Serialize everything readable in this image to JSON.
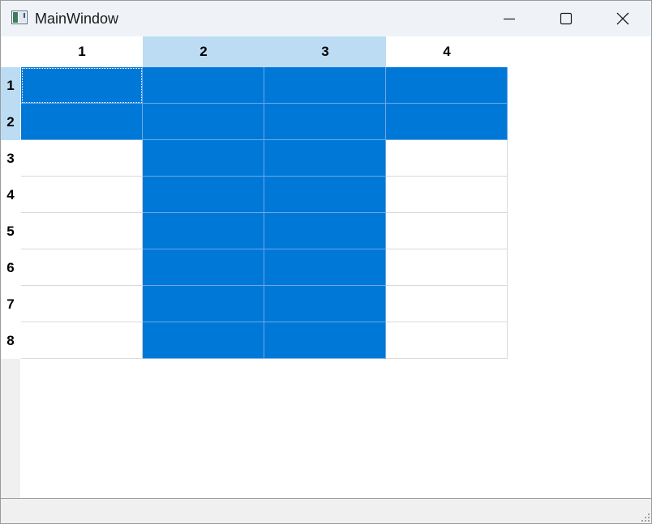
{
  "window": {
    "title": "MainWindow",
    "minimize_icon": "minimize-icon",
    "maximize_icon": "maximize-icon",
    "close_icon": "close-icon",
    "app_icon": "app-window-icon"
  },
  "table": {
    "columns": [
      "1",
      "2",
      "3",
      "4"
    ],
    "rows": [
      "1",
      "2",
      "3",
      "4",
      "5",
      "6",
      "7",
      "8"
    ],
    "selected_rows": [
      "1",
      "2"
    ],
    "selected_columns": [
      "2",
      "3"
    ],
    "focused_cell": {
      "row": "1",
      "column": "1"
    }
  },
  "colors": {
    "selection": "#0078d7",
    "header_highlight": "#bcdcf4",
    "gridline": "#d9d9d9",
    "titlebar": "#eff3f8"
  }
}
